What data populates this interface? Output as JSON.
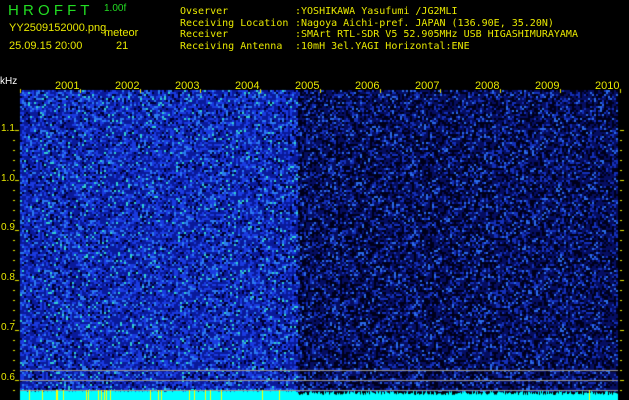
{
  "header": {
    "app_title": "H R O F F T",
    "version": "1.00f",
    "filename": "YY2509152000.png",
    "datetime": "25.09.15 20:00",
    "meteor_label": "meteor",
    "meteor_count": "21"
  },
  "info": [
    {
      "label": "Ovserver",
      "value": ":YOSHIKAWA Yasufumi /JG2MLI"
    },
    {
      "label": "Receiving Location",
      "value": ":Nagoya Aichi-pref. JAPAN (136.90E, 35.20N)"
    },
    {
      "label": "Receiver",
      "value": ":SMArt RTL-SDR V5 52.905MHz USB HIGASHIMURAYAMA"
    },
    {
      "label": "Receiving Antenna",
      "value": ":10mH 3el.YAGI Horizontal:ENE"
    }
  ],
  "spectrogram": {
    "y_unit": "kHz",
    "y_ticks": [
      "1.1",
      "1.0",
      "0.9",
      "0.8",
      "0.7",
      "0.6"
    ],
    "x_ticks": [
      "2001",
      "2002",
      "2003",
      "2004",
      "2005",
      "2006",
      "2007",
      "2008",
      "2009",
      "2010"
    ],
    "colors": {
      "text": "#e8e800",
      "title": "#22dd22",
      "baseline": "#00ffff",
      "meteor": "#ffff00"
    }
  }
}
